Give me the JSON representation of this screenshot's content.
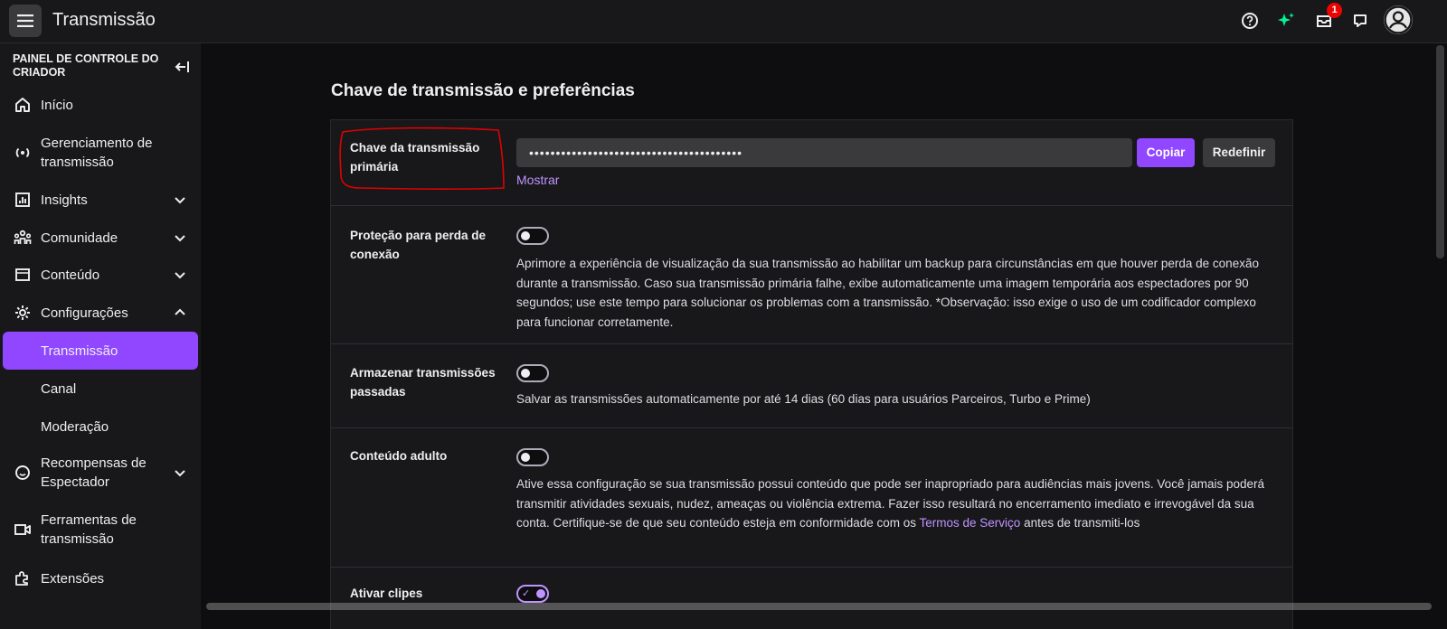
{
  "topbar": {
    "title": "Transmissão",
    "notification_count": "1"
  },
  "sidebar": {
    "header": "PAINEL DE CONTROLE DO CRIADOR",
    "items": [
      {
        "label": "Início",
        "icon": "home-icon"
      },
      {
        "label": "Gerenciamento de transmissão",
        "icon": "broadcast-icon"
      },
      {
        "label": "Insights",
        "icon": "chart-icon",
        "chevron": "down"
      },
      {
        "label": "Comunidade",
        "icon": "community-icon",
        "chevron": "down"
      },
      {
        "label": "Conteúdo",
        "icon": "content-icon",
        "chevron": "down"
      },
      {
        "label": "Configurações",
        "icon": "gear-icon",
        "chevron": "up"
      },
      {
        "label": "Transmissão",
        "active": true
      },
      {
        "label": "Canal"
      },
      {
        "label": "Moderação"
      },
      {
        "label": "Recompensas de Espectador",
        "icon": "rewards-icon",
        "chevron": "down"
      },
      {
        "label": "Ferramentas de transmissão",
        "icon": "camera-icon"
      },
      {
        "label": "Extensões",
        "icon": "puzzle-icon"
      }
    ]
  },
  "main": {
    "title": "Chave de transmissão e preferências",
    "stream_key": {
      "label": "Chave da transmissão primária",
      "value": "••••••••••••••••••••••••••••••••••••••••",
      "copy_label": "Copiar",
      "reset_label": "Redefinir",
      "show_label": "Mostrar"
    },
    "disconnect": {
      "label": "Proteção para perda de conexão",
      "enabled": false,
      "description": "Aprimore a experiência de visualização da sua transmissão ao habilitar um backup para circunstâncias em que houver perda de conexão durante a transmissão. Caso sua transmissão primária falhe, exibe automaticamente uma imagem temporária aos espectadores por 90 segundos; use este tempo para solucionar os problemas com a transmissão. *Observação: isso exige o uso de um codificador complexo para funcionar corretamente."
    },
    "vods": {
      "label": "Armazenar transmissões passadas",
      "enabled": false,
      "description": "Salvar as transmissões automaticamente por até 14 dias (60 dias para usuários Parceiros, Turbo e Prime)"
    },
    "mature": {
      "label": "Conteúdo adulto",
      "enabled": false,
      "description_before": "Ative essa configuração se sua transmissão possui conteúdo que pode ser inapropriado para audiências mais jovens. Você jamais poderá transmitir atividades sexuais, nudez, ameaças ou violência extrema. Fazer isso resultará no encerramento imediato e irrevogável da sua conta. Certifique-se de que seu conteúdo esteja em conformidade com os ",
      "tos_link": "Termos de Serviço",
      "description_after": " antes de transmiti-los"
    },
    "clips": {
      "label": "Ativar clipes",
      "enabled": true
    }
  },
  "colors": {
    "accent": "#9147ff",
    "link": "#bf94ff",
    "annotation": "#e00000"
  }
}
